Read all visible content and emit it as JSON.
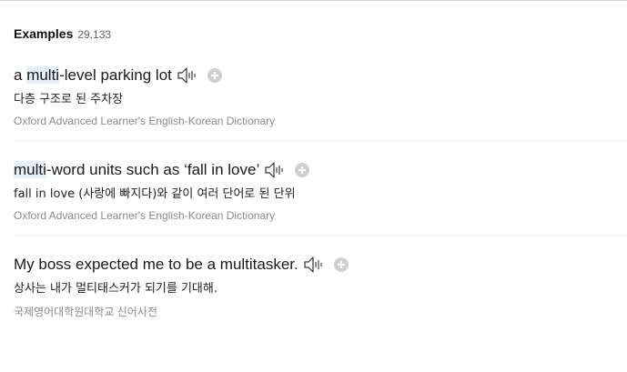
{
  "header": {
    "title": "Examples",
    "count": "29,133"
  },
  "examples": [
    {
      "pre": "a ",
      "highlight": "multi",
      "post": "-level parking lot",
      "translation": "다층 구조로 된 주차장",
      "source": "Oxford Advanced Learner's English-Korean Dictionary"
    },
    {
      "pre": "",
      "highlight": "multi",
      "post": "-word units such as ‘fall in love’",
      "translation": "fall in love (사랑에 빠지다)와 같이 여러 단어로 된 단위",
      "source": "Oxford Advanced Learner's English-Korean Dictionary"
    },
    {
      "pre": "My boss expected me to be a multitasker.",
      "highlight": "",
      "post": "",
      "translation": "상사는 내가 멀티태스커가 되기를 기대해.",
      "source": "국제영어대학원대학교 신어사전"
    }
  ],
  "icons": {
    "speaker": "speaker-icon",
    "add": "plus-circle-icon"
  },
  "colors": {
    "highlight": "#e6f0fb",
    "source_text": "#8a8a8a",
    "add_button": "#cfcfcf"
  }
}
